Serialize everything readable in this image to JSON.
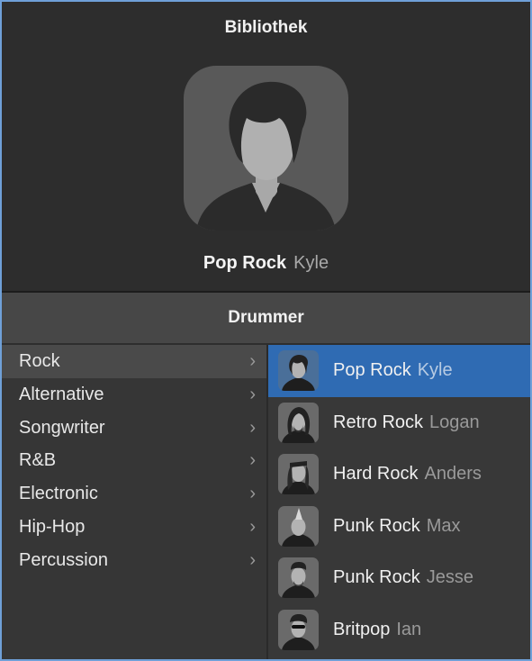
{
  "library": {
    "title": "Bibliothek",
    "selected": {
      "style": "Pop Rock",
      "name": "Kyle"
    }
  },
  "drummer_header": "Drummer",
  "genres": [
    {
      "label": "Rock",
      "selected": true
    },
    {
      "label": "Alternative"
    },
    {
      "label": "Songwriter"
    },
    {
      "label": "R&B"
    },
    {
      "label": "Electronic"
    },
    {
      "label": "Hip-Hop"
    },
    {
      "label": "Percussion"
    }
  ],
  "drummers": [
    {
      "style": "Pop Rock",
      "name": "Kyle",
      "selected": true
    },
    {
      "style": "Retro Rock",
      "name": "Logan"
    },
    {
      "style": "Hard Rock",
      "name": "Anders"
    },
    {
      "style": "Punk Rock",
      "name": "Max"
    },
    {
      "style": "Punk Rock",
      "name": "Jesse"
    },
    {
      "style": "Britpop",
      "name": "Ian"
    }
  ],
  "icons": {
    "chevron": "chevron-right-icon",
    "portrait": "drummer-portrait-icon"
  },
  "colors": {
    "selection": "#2f6bb3",
    "frame": "#6fa0d8"
  }
}
